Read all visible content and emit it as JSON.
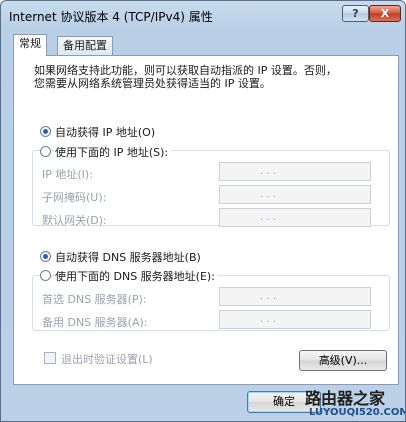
{
  "window": {
    "title": "Internet 协议版本 4 (TCP/IPv4) 属性",
    "help_button": "?",
    "close_button": "X"
  },
  "tabs": [
    {
      "label": "常规",
      "active": true
    },
    {
      "label": "备用配置",
      "active": false
    }
  ],
  "description": {
    "line1": "如果网络支持此功能，则可以获取自动指派的 IP 设置。否则，",
    "line2": "您需要从网络系统管理员处获得适当的 IP 设置。"
  },
  "ip": {
    "auto_label": "自动获得 IP 地址(O)",
    "auto_selected": true,
    "manual_label": "使用下面的 IP 地址(S):",
    "manual_selected": false,
    "fields": [
      {
        "label": "IP 地址(I):",
        "value": ". . ."
      },
      {
        "label": "子网掩码(U):",
        "value": ". . ."
      },
      {
        "label": "默认网关(D):",
        "value": ". . ."
      }
    ]
  },
  "dns": {
    "auto_label": "自动获得 DNS 服务器地址(B)",
    "auto_selected": true,
    "manual_label": "使用下面的 DNS 服务器地址(E):",
    "manual_selected": false,
    "fields": [
      {
        "label": "首选 DNS 服务器(P):",
        "value": ". . ."
      },
      {
        "label": "备用 DNS 服务器(A):",
        "value": ". . ."
      }
    ]
  },
  "validate_label": "退出时验证设置(L)",
  "validate_checked": false,
  "advanced_button": "高级(V)...",
  "ok_button": "确定",
  "watermark": {
    "title": "路由器之家",
    "url": "LUYOUQI520.COM"
  }
}
